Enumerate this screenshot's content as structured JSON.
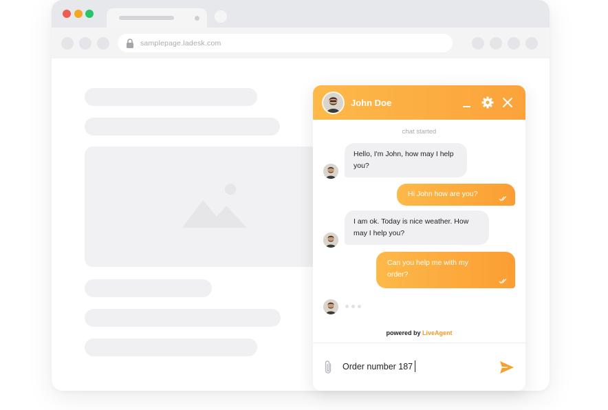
{
  "browser": {
    "url": "samplepage.ladesk.com",
    "traffic_colors": {
      "close": "#ee5d50",
      "minimize": "#f5a623",
      "maximize": "#29c46a"
    }
  },
  "chat": {
    "agent_name": "John Doe",
    "system_message": "chat started",
    "messages": [
      {
        "direction": "incoming",
        "text": "Hello, I'm John, how may I help you?"
      },
      {
        "direction": "outgoing",
        "text": "Hi John how are you?"
      },
      {
        "direction": "incoming",
        "text": "I am ok. Today is nice weather. How may I help you?"
      },
      {
        "direction": "outgoing",
        "text": "Can you help me with my order?"
      }
    ],
    "powered_by_label": "powered by",
    "powered_by_brand": "LiveAgent",
    "input_value": "Order number 187",
    "colors": {
      "accent": "#fba33a",
      "brand": "#f29a24"
    },
    "icons": {
      "minimize": "minimize-icon",
      "settings": "gear-icon",
      "close": "close-icon",
      "attach": "paperclip-icon",
      "send": "send-icon"
    }
  }
}
